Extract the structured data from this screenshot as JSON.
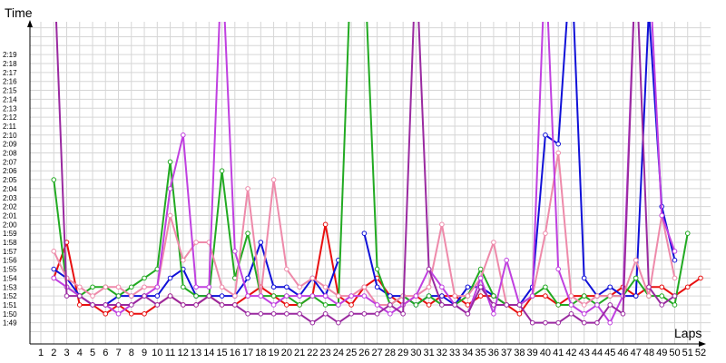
{
  "chart_data": {
    "type": "line",
    "ylabel": "Time",
    "xlabel": "Laps",
    "y_unit": "seconds (tick labels shown as m:ss)",
    "ylim": [
      108,
      142
    ],
    "xlim": [
      1,
      52
    ],
    "grid": true,
    "x": [
      1,
      2,
      3,
      4,
      5,
      6,
      7,
      8,
      9,
      10,
      11,
      12,
      13,
      14,
      15,
      16,
      17,
      18,
      19,
      20,
      21,
      22,
      23,
      24,
      25,
      26,
      27,
      28,
      29,
      30,
      31,
      32,
      33,
      34,
      35,
      36,
      37,
      38,
      39,
      40,
      41,
      42,
      43,
      44,
      45,
      46,
      47,
      48,
      49,
      50,
      51,
      52
    ],
    "y_ticks": [
      109,
      110,
      111,
      112,
      113,
      114,
      115,
      116,
      117,
      118,
      119,
      120,
      121,
      122,
      123,
      124,
      125,
      126,
      127,
      128,
      129,
      130,
      131,
      132,
      133,
      134,
      135,
      136,
      137,
      138,
      139
    ],
    "y_tick_labels": [
      "1:49",
      "1:50",
      "1:51",
      "1:52",
      "1:53",
      "1:54",
      "1:55",
      "1:56",
      "1:57",
      "1:58",
      "1:59",
      "2:00",
      "2:01",
      "2:02",
      "2:03",
      "2:04",
      "2:05",
      "2:06",
      "2:07",
      "2:08",
      "2:09",
      "2:10",
      "2:11",
      "2:12",
      "2:13",
      "2:14",
      "2:15",
      "2:16",
      "2:17",
      "2:18",
      "2:19"
    ],
    "x_tick_labels": [
      "1",
      "2",
      "3",
      "4",
      "5",
      "6",
      "7",
      "8",
      "9",
      "10",
      "11",
      "12",
      "13",
      "14",
      "15",
      "16",
      "17",
      "18",
      "19",
      "20",
      "21",
      "22",
      "23",
      "24",
      "25",
      "26",
      "27",
      "28",
      "29",
      "30",
      "31",
      "32",
      "33",
      "34",
      "35",
      "36",
      "37",
      "38",
      "39",
      "40",
      "41",
      "42",
      "43",
      "44",
      "45",
      "46",
      "47",
      "48",
      "49",
      "50",
      "51",
      "52"
    ],
    "series": [
      {
        "color": "#e81010",
        "values": [
          null,
          114,
          118,
          111,
          111,
          110,
          111,
          110,
          110,
          111,
          112,
          111,
          111,
          112,
          111,
          111,
          112,
          113,
          112,
          111,
          111,
          112,
          120,
          112,
          111,
          113,
          114,
          112,
          111,
          112,
          111,
          112,
          112,
          111,
          112,
          112,
          111,
          110,
          112,
          112,
          111,
          112,
          112,
          112,
          112,
          113,
          112,
          113,
          113,
          112,
          113,
          114
        ]
      },
      {
        "color": "#1010d8",
        "values": [
          null,
          115,
          114,
          112,
          111,
          111,
          112,
          112,
          112,
          112,
          114,
          115,
          112,
          112,
          112,
          112,
          114,
          118,
          113,
          113,
          112,
          114,
          112,
          116,
          null,
          119,
          113,
          112,
          112,
          111,
          112,
          112,
          111,
          113,
          113,
          112,
          111,
          111,
          113,
          130,
          129,
          150,
          114,
          112,
          113,
          112,
          112,
          144,
          122,
          116,
          null,
          null
        ]
      },
      {
        "color": "#22aa22",
        "values": [
          null,
          125,
          113,
          112,
          113,
          113,
          112,
          113,
          114,
          115,
          127,
          113,
          112,
          112,
          126,
          114,
          119,
          112,
          112,
          112,
          111,
          112,
          111,
          111,
          150,
          150,
          115,
          111,
          112,
          111,
          112,
          111,
          111,
          112,
          115,
          112,
          111,
          111,
          112,
          113,
          111,
          111,
          112,
          111,
          112,
          112,
          114,
          112,
          112,
          111,
          119,
          null
        ]
      },
      {
        "color": "#ee8aaa",
        "values": [
          null,
          117,
          114,
          113,
          112,
          113,
          113,
          112,
          113,
          113,
          121,
          116,
          118,
          118,
          113,
          112,
          124,
          112,
          125,
          115,
          113,
          114,
          113,
          112,
          112,
          113,
          111,
          111,
          112,
          112,
          113,
          120,
          112,
          112,
          114,
          118,
          111,
          111,
          112,
          119,
          128,
          112,
          111,
          112,
          112,
          112,
          116,
          112,
          121,
          114,
          null,
          null
        ]
      },
      {
        "color": "#c040e0",
        "values": [
          null,
          114,
          113,
          112,
          111,
          111,
          110,
          111,
          112,
          113,
          124,
          130,
          113,
          113,
          150,
          117,
          112,
          112,
          111,
          112,
          112,
          112,
          112,
          111,
          112,
          112,
          111,
          110,
          111,
          112,
          115,
          113,
          111,
          110,
          114,
          110,
          116,
          111,
          112,
          150,
          115,
          111,
          110,
          111,
          109,
          112,
          150,
          150,
          121,
          117,
          null,
          null
        ]
      },
      {
        "color": "#9a2aa0",
        "values": [
          null,
          150,
          112,
          112,
          111,
          111,
          111,
          111,
          112,
          111,
          112,
          111,
          111,
          112,
          111,
          111,
          110,
          110,
          110,
          110,
          110,
          109,
          110,
          109,
          110,
          110,
          110,
          111,
          110,
          150,
          115,
          111,
          111,
          110,
          113,
          111,
          111,
          111,
          109,
          109,
          109,
          110,
          109,
          109,
          111,
          110,
          150,
          113,
          111,
          112,
          null,
          null
        ]
      }
    ]
  }
}
